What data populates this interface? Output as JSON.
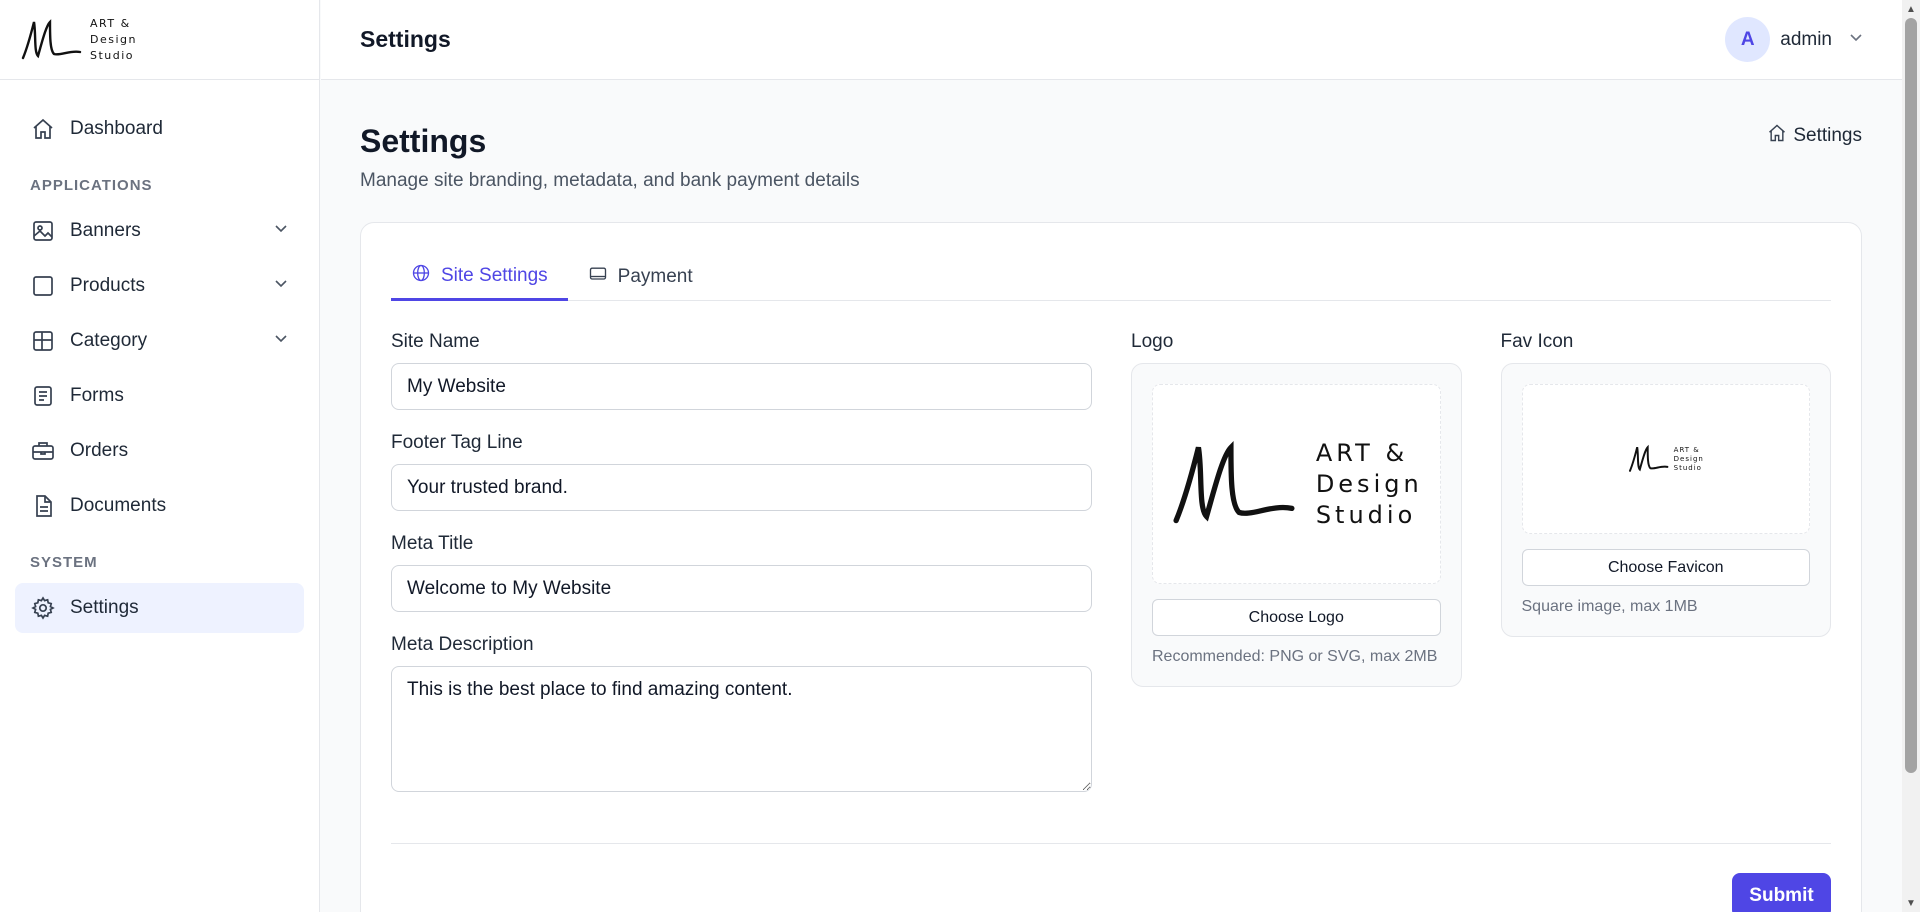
{
  "brand": {
    "line1": "ART &",
    "line2": "Design",
    "line3": "Studio"
  },
  "sidebar": {
    "items": [
      {
        "label": "Dashboard",
        "icon": "home-icon"
      },
      {
        "label": "Banners",
        "icon": "image-icon"
      },
      {
        "label": "Products",
        "icon": "square-icon"
      },
      {
        "label": "Category",
        "icon": "grid-icon"
      },
      {
        "label": "Forms",
        "icon": "form-icon"
      },
      {
        "label": "Orders",
        "icon": "briefcase-icon"
      },
      {
        "label": "Documents",
        "icon": "document-icon"
      },
      {
        "label": "Settings",
        "icon": "gear-icon"
      }
    ],
    "sections": {
      "applications": "APPLICATIONS",
      "system": "SYSTEM"
    }
  },
  "header": {
    "title": "Settings",
    "avatar_letter": "A",
    "user": "admin"
  },
  "page": {
    "title": "Settings",
    "subtitle": "Manage site branding, metadata, and bank payment details",
    "breadcrumb": "Settings"
  },
  "tabs": [
    {
      "label": "Site Settings",
      "icon": "globe-icon"
    },
    {
      "label": "Payment",
      "icon": "card-icon"
    }
  ],
  "form": {
    "site_name": {
      "label": "Site Name",
      "value": "My Website"
    },
    "footer_tag_line": {
      "label": "Footer Tag Line",
      "value": "Your trusted brand."
    },
    "meta_title": {
      "label": "Meta Title",
      "value": "Welcome to My Website"
    },
    "meta_description": {
      "label": "Meta Description",
      "value": "This is the best place to find amazing content."
    }
  },
  "logo": {
    "label": "Logo",
    "button": "Choose Logo",
    "hint": "Recommended: PNG or SVG, max 2MB"
  },
  "favicon": {
    "label": "Fav Icon",
    "button": "Choose Favicon",
    "hint": "Square image, max 1MB"
  },
  "submit_label": "Submit",
  "colors": {
    "accent": "#4f46e5",
    "accent_light": "#eef2ff"
  }
}
